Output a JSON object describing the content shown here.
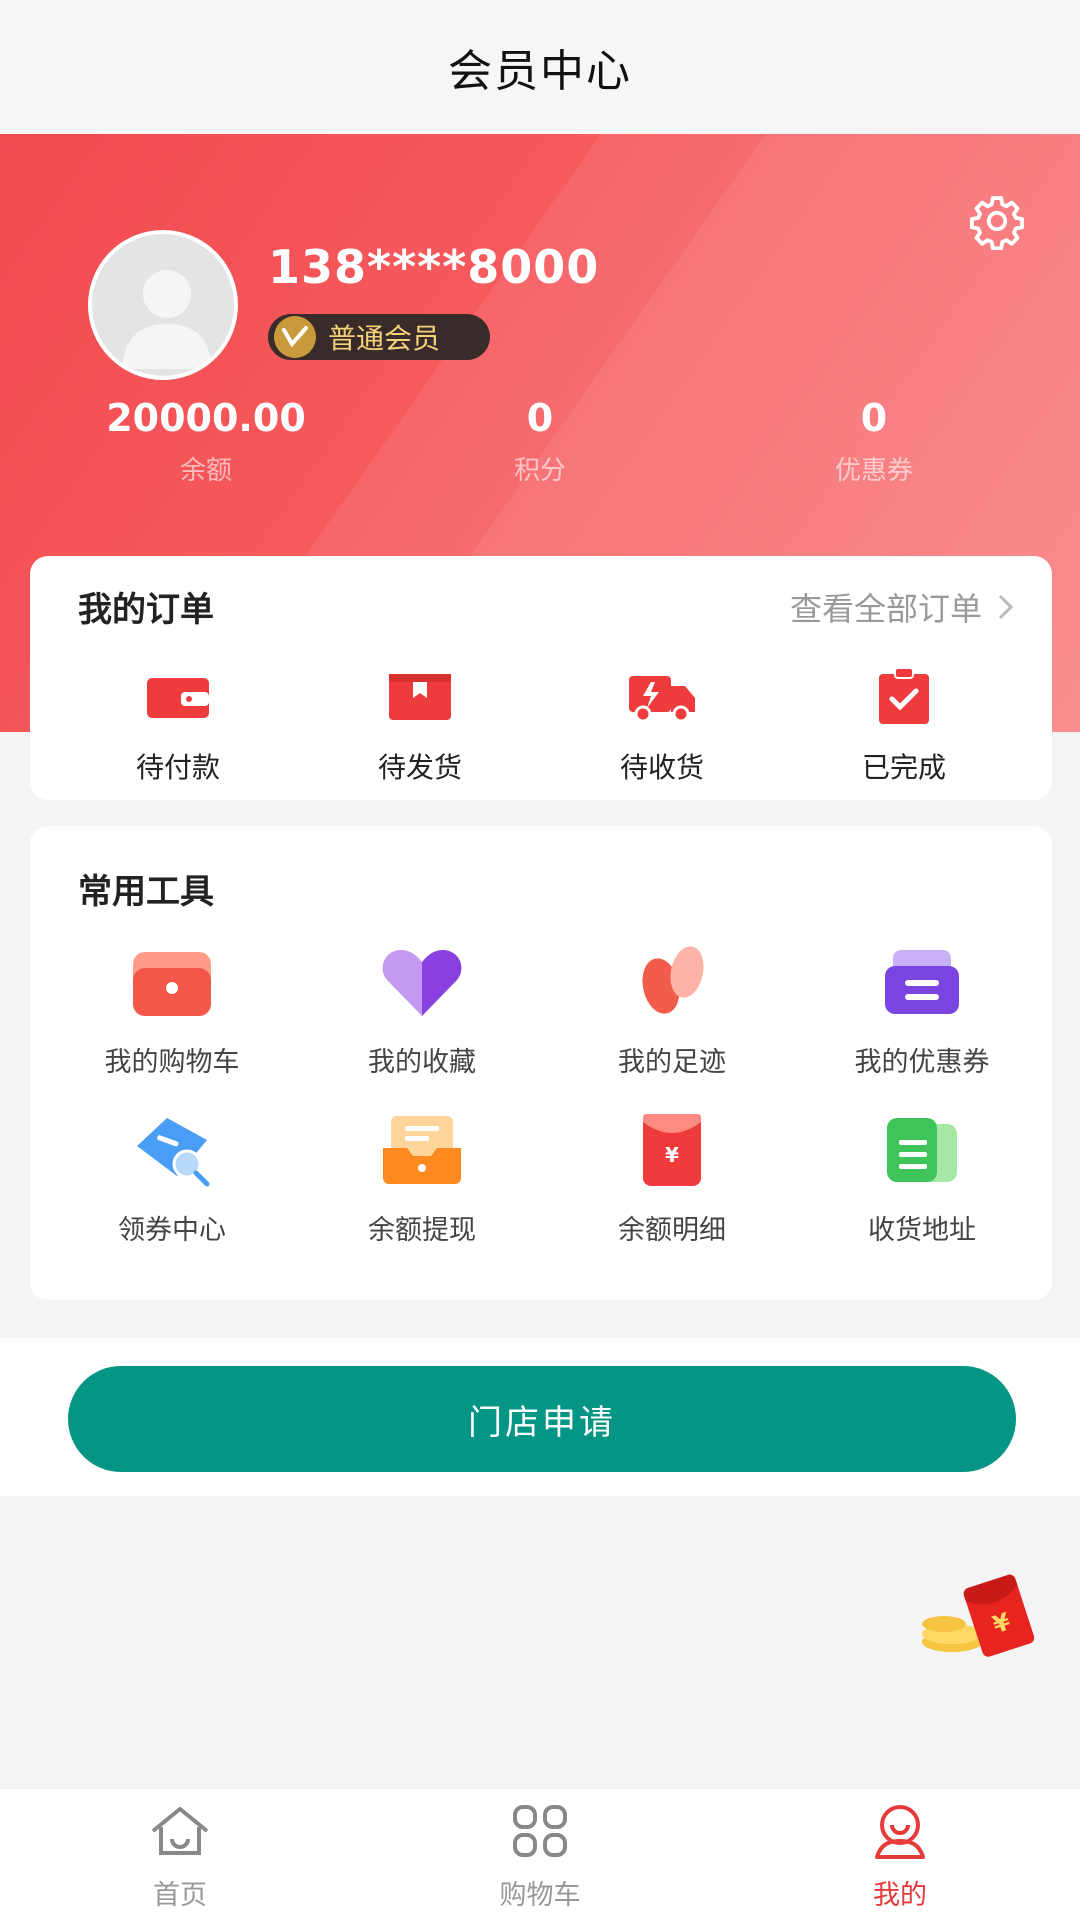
{
  "header": {
    "title": "会员中心"
  },
  "profile": {
    "phone": "138****8000",
    "member_level": "普通会员"
  },
  "stats": [
    {
      "value": "20000.00",
      "label": "余额"
    },
    {
      "value": "0",
      "label": "积分"
    },
    {
      "value": "0",
      "label": "优惠券"
    }
  ],
  "orders": {
    "title": "我的订单",
    "view_all": "查看全部订单",
    "items": [
      {
        "label": "待付款",
        "icon": "wallet-icon"
      },
      {
        "label": "待发货",
        "icon": "box-icon"
      },
      {
        "label": "待收货",
        "icon": "truck-icon"
      },
      {
        "label": "已完成",
        "icon": "clipboard-check-icon"
      }
    ]
  },
  "tools": {
    "title": "常用工具",
    "items": [
      {
        "label": "我的购物车",
        "icon": "cart-bag-icon"
      },
      {
        "label": "我的收藏",
        "icon": "heart-icon"
      },
      {
        "label": "我的足迹",
        "icon": "footprint-icon"
      },
      {
        "label": "我的优惠券",
        "icon": "ticket-icon"
      },
      {
        "label": "领券中心",
        "icon": "coupon-search-icon"
      },
      {
        "label": "余额提现",
        "icon": "withdraw-box-icon"
      },
      {
        "label": "余额明细",
        "icon": "red-envelope-icon"
      },
      {
        "label": "收货地址",
        "icon": "address-icon"
      }
    ]
  },
  "store_button": "门店申请",
  "tabbar": [
    {
      "label": "首页",
      "icon": "home-icon",
      "active": false
    },
    {
      "label": "购物车",
      "icon": "grid-icon",
      "active": false
    },
    {
      "label": "我的",
      "icon": "user-icon",
      "active": true
    }
  ],
  "colors": {
    "primary_red": "#f24a4f",
    "teal_button": "#049584",
    "active_tab": "#e63a3a"
  }
}
